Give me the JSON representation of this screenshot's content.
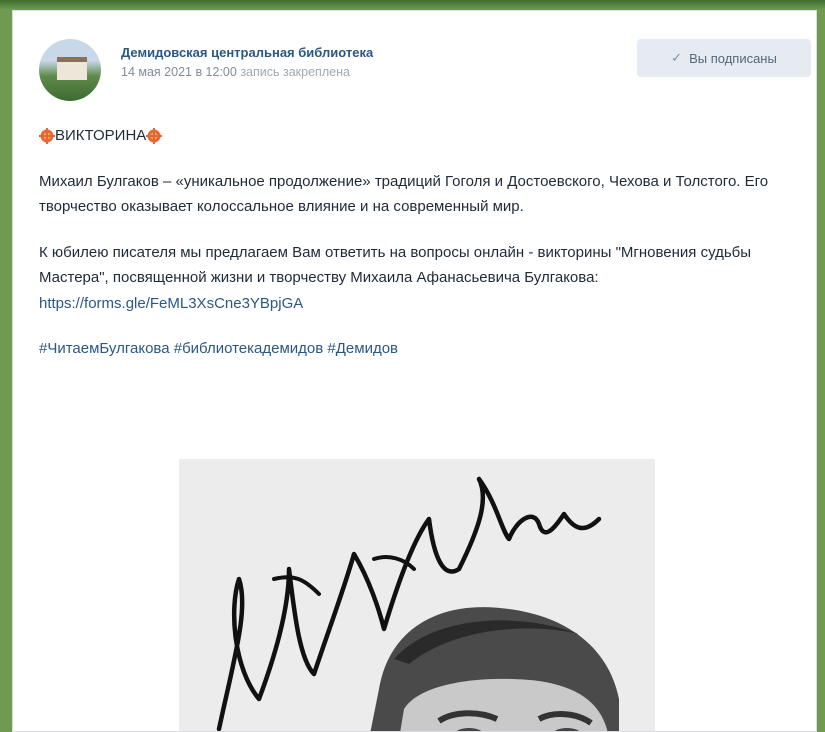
{
  "post": {
    "group_name": "Демидовская центральная библиотека",
    "date": "14 мая 2021 в 12:00",
    "pinned_text": "запись закреплена",
    "subscribe_label": "Вы подписаны",
    "subscribe_icon": "check-icon",
    "title": "ВИКТОРИНА",
    "title_icon": "burst-emoji-icon",
    "paragraph1": "Михаил Булгаков – «уникальное продолжение» традиций Гоголя и Достоевского, Чехова и Толстого. Его творчество оказывает колоссальное влияние и на современный мир.",
    "paragraph2_text": "К юбилею писателя мы предлагаем Вам ответить на вопросы онлайн - викторины \"Мгновения судьбы Мастера\", посвященной жизни и творчеству Михаила Афанасьевича Булгакова: ",
    "paragraph2_link": "https://forms.gle/FeML3XsCne3YBpjGA",
    "hashtags": [
      "#ЧитаемБулгакова",
      "#библиотекадемидов",
      "#Демидов"
    ],
    "colors": {
      "link": "#2a5885",
      "muted": "#818c99",
      "button_bg": "#e5ebf1",
      "frame": "#6e9a52"
    }
  }
}
